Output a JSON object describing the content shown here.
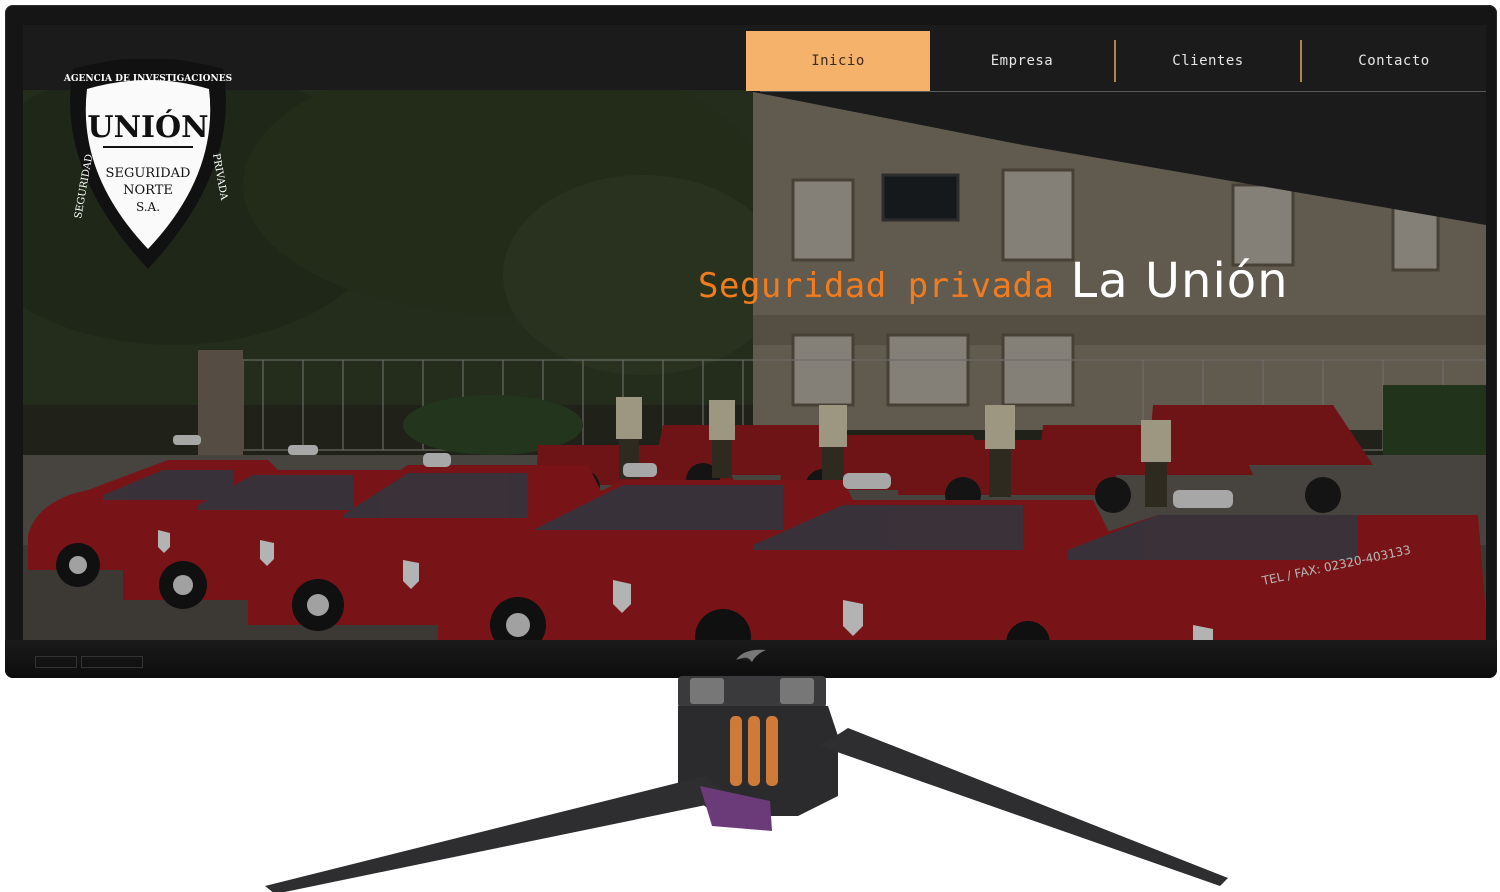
{
  "nav": {
    "items": [
      {
        "label": "Inicio",
        "active": true
      },
      {
        "label": "Empresa",
        "active": false
      },
      {
        "label": "Clientes",
        "active": false
      },
      {
        "label": "Contacto",
        "active": false
      }
    ]
  },
  "logo": {
    "agency": "AGENCIA DE INVESTIGACIONES",
    "name": "UNIÓN",
    "line1": "SEGURIDAD",
    "line2": "NORTE",
    "line3": "S.A.",
    "left_arc": "SEGURIDAD",
    "right_arc": "PRIVADA"
  },
  "hero": {
    "headline_orange": "Seguridad privada",
    "headline_white": "La Unión",
    "vehicle_phone": "TEL / FAX: 02320-403133"
  },
  "colors": {
    "accent": "#f5b26b",
    "headline_orange": "#f07c1f",
    "nav_bg": "#1b1b1b",
    "vehicle_red": "#9a1a1e"
  },
  "icons": {
    "brand": "rog-eye-icon"
  }
}
